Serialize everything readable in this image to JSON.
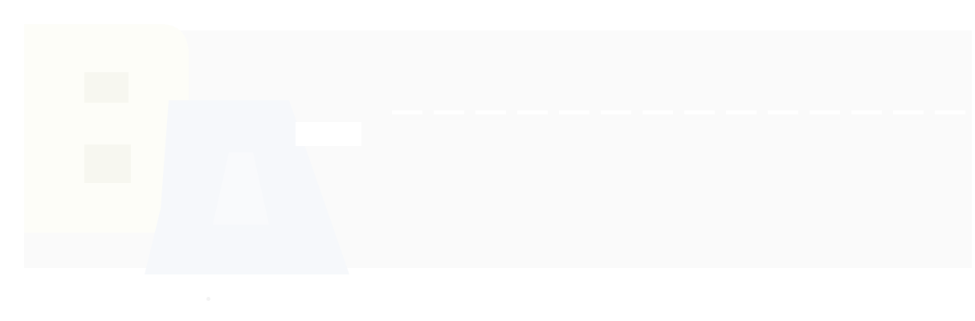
{
  "image": {
    "description_hidden": "",
    "colors": {
      "background": "#ffffff",
      "panel": "#fafafa",
      "letter_b_fill": "#fdfdf8",
      "letter_a_fill": "#f6f8fb",
      "rule": "#ffffff"
    },
    "logo": {
      "lettering": "BA",
      "icon": "ba-logo-icon"
    }
  }
}
